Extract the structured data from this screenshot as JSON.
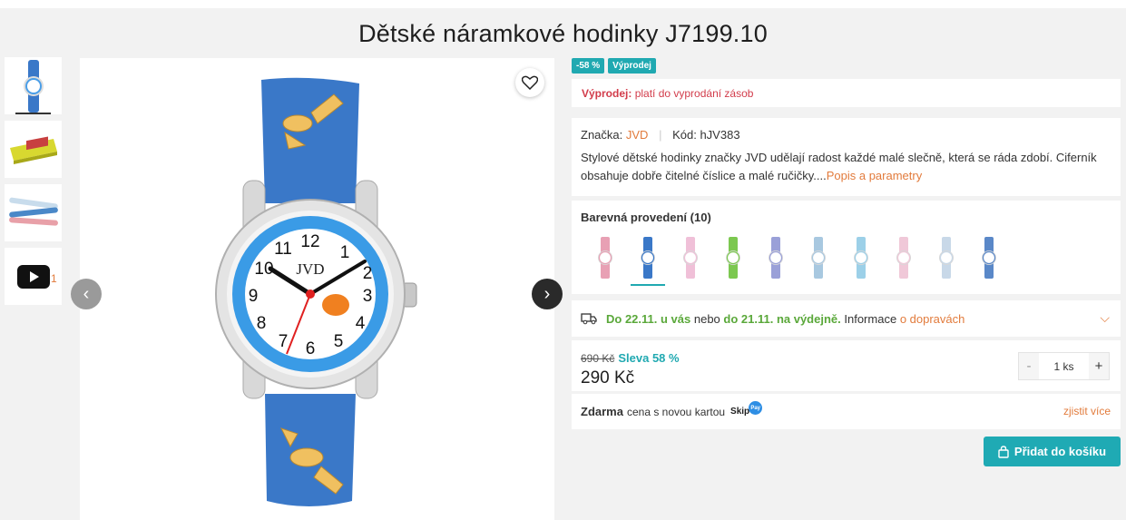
{
  "product": {
    "title": "Dětské náramkové hodinky J7199.10"
  },
  "gallery": {
    "thumb_count": "1"
  },
  "badges": [
    "-58 %",
    "Výprodej"
  ],
  "sale": {
    "label": "Výprodej:",
    "text": "platí do vyprodání zásob"
  },
  "info": {
    "brand_label": "Značka:",
    "brand": "JVD",
    "code_label": "Kód:",
    "code": "hJV383",
    "description": "Stylové dětské hodinky značky JVD udělají radost každé malé slečně, která se ráda zdobí. Ciferník obsahuje dobře čitelné číslice a malé ručičky....",
    "more_link": "Popis a parametry"
  },
  "variants": {
    "heading": "Barevná provedení (10)",
    "strap_colors": [
      "#e8a0b4",
      "#3a78c8",
      "#f0c0d8",
      "#7cc850",
      "#9aa0d8",
      "#a8c8e0",
      "#9cd0e8",
      "#f0c8d8",
      "#c8d8e8",
      "#5a88c8"
    ]
  },
  "delivery": {
    "date_home": "Do 22.11. u vás",
    "middle": "nebo",
    "date_pickup": "do 21.11. na výdejně.",
    "info": "Informace",
    "link": "o dopravách"
  },
  "price": {
    "old": "690 Kč",
    "discount": "Sleva 58 %",
    "current": "290 Kč",
    "quantity": "1 ks",
    "minus": "-",
    "plus": "+"
  },
  "promo": {
    "bold": "Zdarma",
    "text": "cena s novou kartou",
    "brand": "Skip",
    "brand_badge": "Pay",
    "link": "zjistit více"
  },
  "cart": {
    "label": "Přidat do košíku"
  },
  "colors": {
    "accent": "#1faab4",
    "orange": "#e27b3c",
    "sale_red": "#d23c4b",
    "green": "#5aa83a"
  }
}
